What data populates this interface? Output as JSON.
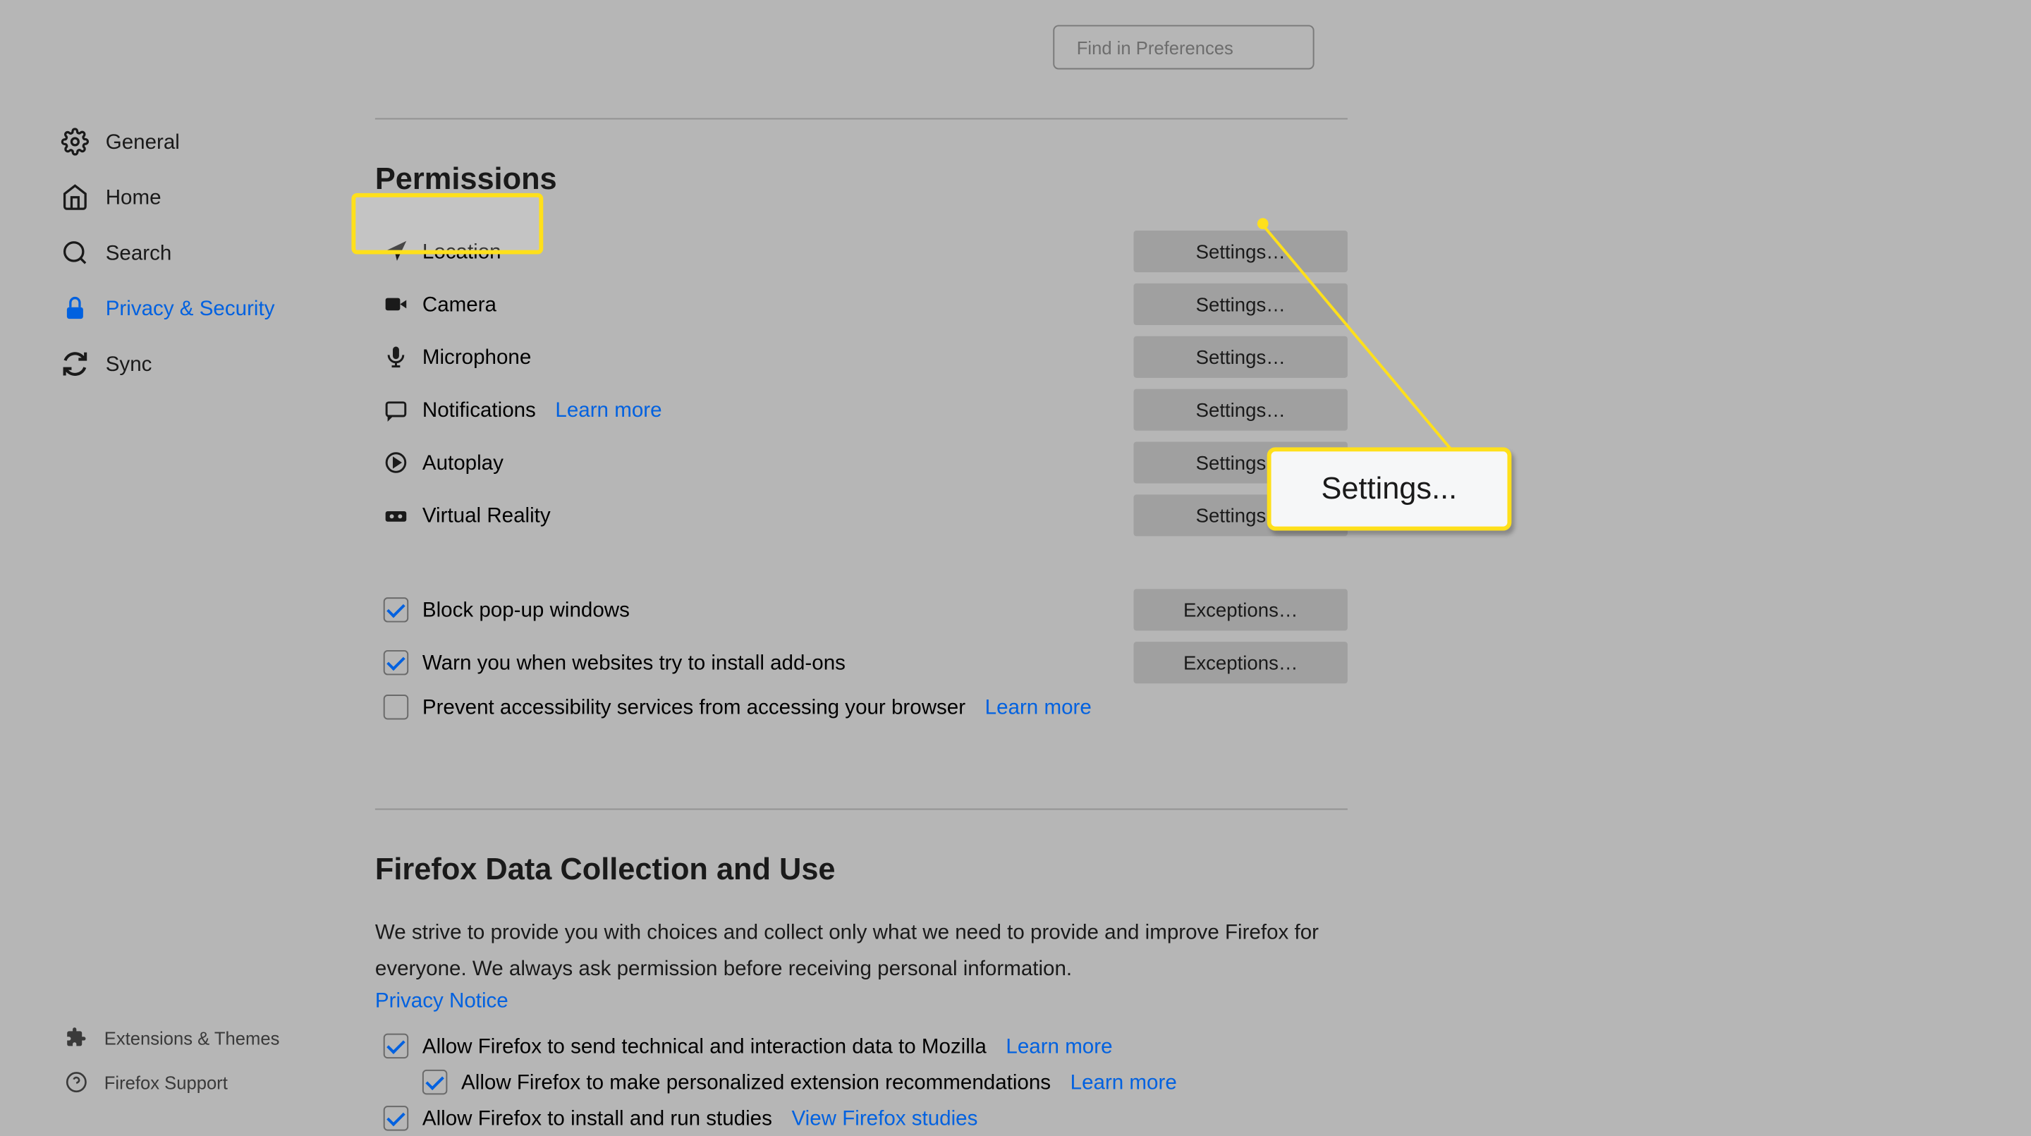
{
  "search": {
    "placeholder": "Find in Preferences"
  },
  "sidebar": {
    "items": [
      {
        "label": "General"
      },
      {
        "label": "Home"
      },
      {
        "label": "Search"
      },
      {
        "label": "Privacy & Security"
      },
      {
        "label": "Sync"
      }
    ],
    "bottom": [
      {
        "label": "Extensions & Themes"
      },
      {
        "label": "Firefox Support"
      }
    ]
  },
  "permissions": {
    "title": "Permissions",
    "rows": [
      {
        "label": "Location",
        "button": "Settings…"
      },
      {
        "label": "Camera",
        "button": "Settings…"
      },
      {
        "label": "Microphone",
        "button": "Settings…"
      },
      {
        "label": "Notifications",
        "button": "Settings…",
        "learn": "Learn more"
      },
      {
        "label": "Autoplay",
        "button": "Settings…"
      },
      {
        "label": "Virtual Reality",
        "button": "Settings…"
      }
    ],
    "checks": [
      {
        "label": "Block pop-up windows",
        "button": "Exceptions…",
        "checked": true
      },
      {
        "label": "Warn you when websites try to install add-ons",
        "button": "Exceptions…",
        "checked": true
      },
      {
        "label": "Prevent accessibility services from accessing your browser",
        "checked": false,
        "learn": "Learn more"
      }
    ]
  },
  "dataCollection": {
    "title": "Firefox Data Collection and Use",
    "desc": "We strive to provide you with choices and collect only what we need to provide and improve Firefox for everyone. We always ask permission before receiving personal information.",
    "privacy": "Privacy Notice",
    "checks": [
      {
        "label": "Allow Firefox to send technical and interaction data to Mozilla",
        "checked": true,
        "learn": "Learn more"
      },
      {
        "label": "Allow Firefox to make personalized extension recommendations",
        "checked": true,
        "learn": "Learn more",
        "indent": true
      },
      {
        "label": "Allow Firefox to install and run studies",
        "checked": true,
        "learn": "View Firefox studies"
      }
    ]
  },
  "callout": {
    "text": "Settings..."
  }
}
